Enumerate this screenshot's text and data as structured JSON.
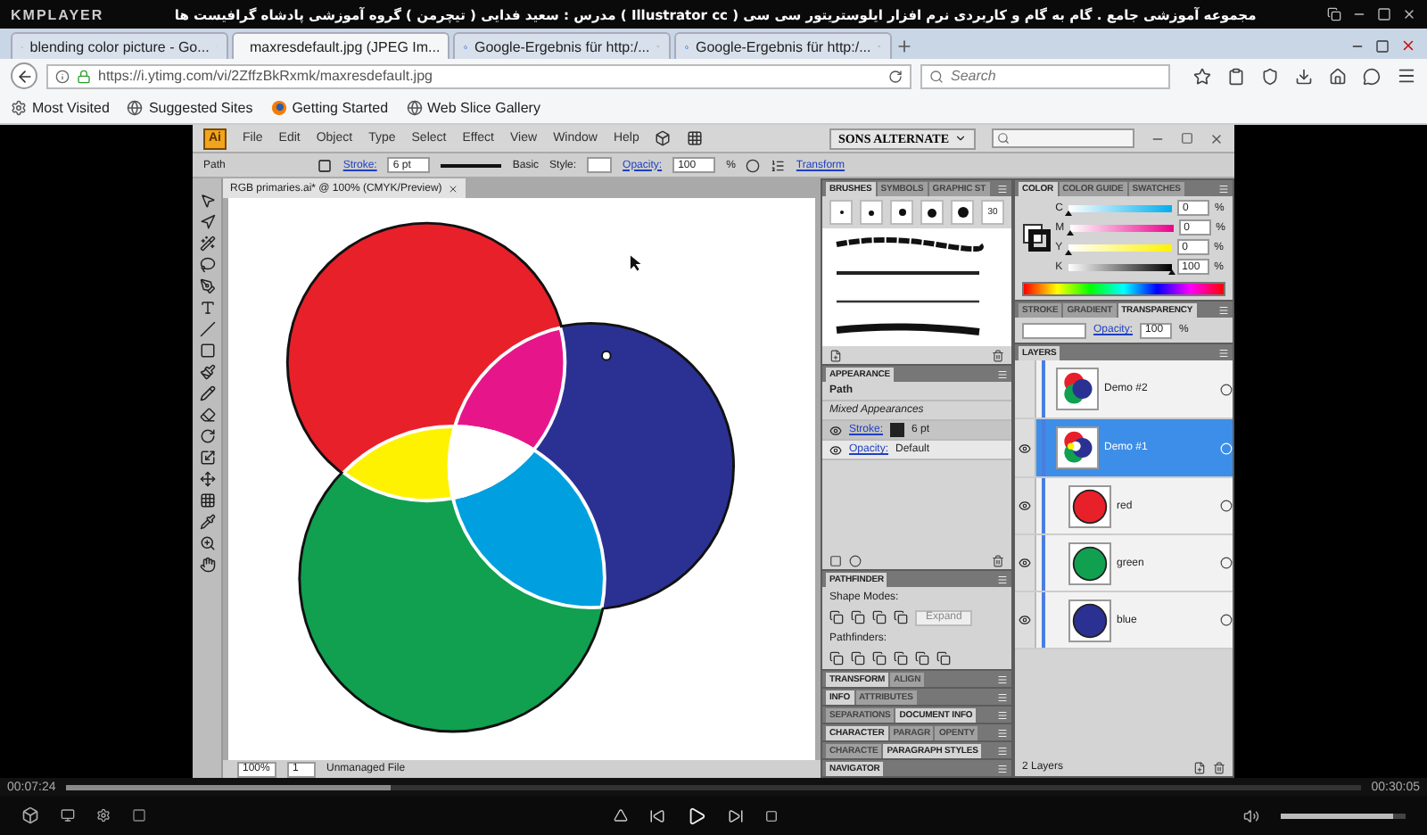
{
  "player": {
    "brand": "KMPLAYER",
    "title": "مجموعه آموزشی جامع . گام به گام و کاربردی نرم افزار ایلوستریتور سی سی ( Illustrator cc )  مدرس : سعید فدایی ( تیچرمن ) گروه آموزشی پادشاه گرافیست ها",
    "elapsed": "00:07:24",
    "total": "00:30:05",
    "progress": {
      "level": 0.25
    },
    "volume": {
      "level": 0.9
    }
  },
  "browser": {
    "tabs": [
      {
        "label": "blending color picture - Go...",
        "selected": false,
        "kind": "google"
      },
      {
        "label": "maxresdefault.jpg (JPEG Im...",
        "selected": true,
        "kind": "image"
      },
      {
        "label": "Google-Ergebnis für http:/...",
        "selected": false,
        "kind": "google"
      },
      {
        "label": "Google-Ergebnis für http:/...",
        "selected": false,
        "kind": "google"
      }
    ],
    "url": "https://i.ytimg.com/vi/2ZffzBkRxmk/maxresdefault.jpg",
    "search": {
      "placeholder": "Search"
    },
    "bookmarks": [
      {
        "label": "Most Visited",
        "kind": "gear"
      },
      {
        "label": "Suggested Sites",
        "kind": "globe"
      },
      {
        "label": "Getting Started",
        "kind": "browser"
      },
      {
        "label": "Web Slice Gallery",
        "kind": "globe"
      }
    ]
  },
  "illustrator": {
    "logo": "Ai",
    "menu": [
      "File",
      "Edit",
      "Object",
      "Type",
      "Select",
      "Effect",
      "View",
      "Window",
      "Help"
    ],
    "workspace": "SONS ALTERNATE",
    "control": {
      "selection": "Path",
      "stroke_label": "Stroke:",
      "stroke_weight": "6 pt",
      "profile": "Basic",
      "style_label": "Style:",
      "opacity_label": "Opacity:",
      "opacity": "100",
      "unit": "%",
      "transform": "Transform"
    },
    "document": {
      "tab": "RGB primaries.ai* @ 100% (CMYK/Preview)",
      "zoom": "100%",
      "artboard": "1",
      "status": "Unmanaged File"
    },
    "brushes": {
      "tabs": [
        {
          "label": "BRUSHES",
          "selected": true
        },
        {
          "label": "SYMBOLS",
          "selected": false
        },
        {
          "label": "GRAPHIC ST",
          "selected": false
        }
      ],
      "tip_size": "30"
    },
    "appearance": {
      "tabs": [
        {
          "label": "APPEARANCE",
          "selected": true
        }
      ],
      "object": "Path",
      "summary": "Mixed Appearances",
      "rows": [
        {
          "label": "Stroke:",
          "value": "6 pt",
          "kind": "stroke"
        },
        {
          "label": "Opacity:",
          "value": "Default",
          "kind": "opacity"
        }
      ]
    },
    "pathfinder": {
      "tabs": [
        {
          "label": "PATHFINDER",
          "selected": true
        }
      ],
      "shape_modes": "Shape Modes:",
      "expand": "Expand",
      "pathfinders": "Pathfinders:"
    },
    "collapsed_panels": [
      {
        "tabs": [
          {
            "label": "TRANSFORM",
            "selected": true
          },
          {
            "label": "ALIGN",
            "selected": false
          }
        ]
      },
      {
        "tabs": [
          {
            "label": "INFO",
            "selected": true
          },
          {
            "label": "ATTRIBUTES",
            "selected": false
          }
        ]
      },
      {
        "tabs": [
          {
            "label": "SEPARATIONS",
            "selected": false
          },
          {
            "label": "DOCUMENT INFO",
            "selected": true
          }
        ]
      },
      {
        "tabs": [
          {
            "label": "CHARACTER",
            "selected": true
          },
          {
            "label": "PARAGR",
            "selected": false
          },
          {
            "label": "OPENTY",
            "selected": false
          }
        ]
      },
      {
        "tabs": [
          {
            "label": "CHARACTE",
            "selected": false
          },
          {
            "label": "PARAGRAPH STYLES",
            "selected": true
          }
        ]
      },
      {
        "tabs": [
          {
            "label": "NAVIGATOR",
            "selected": true
          }
        ]
      }
    ],
    "color": {
      "tabs": [
        {
          "label": "COLOR",
          "selected": true
        },
        {
          "label": "COLOR GUIDE",
          "selected": false
        },
        {
          "label": "SWATCHES",
          "selected": false
        }
      ],
      "sliders": [
        {
          "label": "C",
          "value": "0",
          "unit": "%",
          "level": 0
        },
        {
          "label": "M",
          "value": "0",
          "unit": "%",
          "level": 0
        },
        {
          "label": "Y",
          "value": "0",
          "unit": "%",
          "level": 0
        },
        {
          "label": "K",
          "value": "100",
          "unit": "%",
          "level": 1
        }
      ]
    },
    "transparency": {
      "tabs": [
        {
          "label": "STROKE",
          "selected": false
        },
        {
          "label": "GRADIENT",
          "selected": false
        },
        {
          "label": "TRANSPARENCY",
          "selected": true
        }
      ],
      "opacity_label": "Opacity:",
      "opacity": "100",
      "unit": "%"
    },
    "layers": {
      "tabs": [
        {
          "label": "LAYERS",
          "selected": true
        }
      ],
      "items": [
        {
          "name": "Demo #2",
          "selected": false,
          "visible": false,
          "kind": "stacked"
        },
        {
          "name": "Demo #1",
          "selected": true,
          "visible": true,
          "kind": "blended",
          "children": [
            {
              "name": "red",
              "color": "#e8202a"
            },
            {
              "name": "green",
              "color": "#10a050"
            },
            {
              "name": "blue",
              "color": "#2b3192"
            }
          ]
        }
      ],
      "count": "2 Layers"
    }
  }
}
